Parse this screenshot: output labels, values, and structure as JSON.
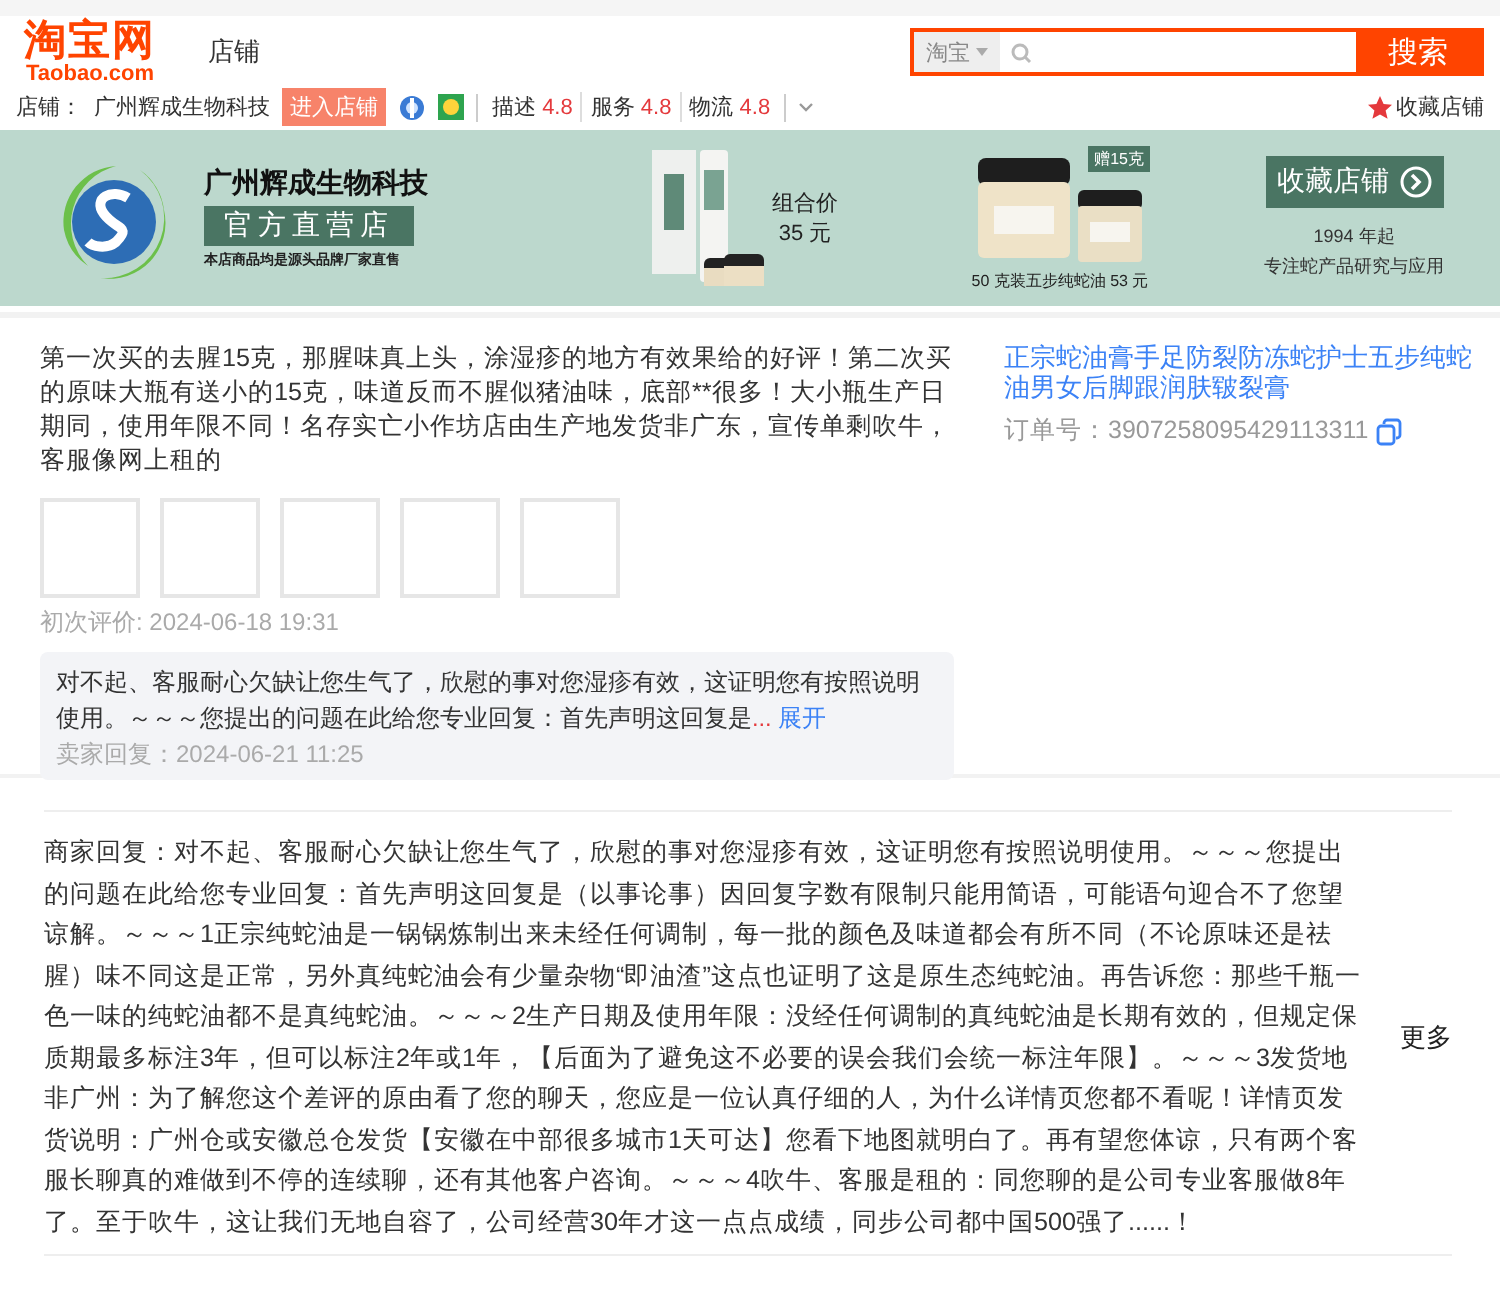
{
  "header": {
    "logo": "淘宝网",
    "logo_sub": "Taobao.com",
    "section": "店铺",
    "search": {
      "scope": "淘宝",
      "button": "搜索"
    }
  },
  "store_bar": {
    "label": "店铺：",
    "name": "广州辉成生物科技",
    "enter_button": "进入店铺",
    "ratings": [
      {
        "label": "描述",
        "score": "4.8"
      },
      {
        "label": "服务",
        "score": "4.8"
      },
      {
        "label": "物流",
        "score": "4.8"
      }
    ],
    "favorite": "收藏店铺"
  },
  "banner": {
    "store_name": "广州辉成生物科技",
    "store_type": "官方直营店",
    "slogan": "本店商品均是源头品牌厂家直售",
    "combo_label": "组合价",
    "combo_price": "35 元",
    "gift_badge": "赠15克",
    "offer": "50 克装五步纯蛇油 53 元",
    "favorite_button": "收藏店铺",
    "since": "1994 年起",
    "focus": "专注蛇产品研究与应用"
  },
  "review": {
    "text": "第一次买的去腥15克，那腥味真上头，涂湿疹的地方有效果给的好评！第二次买的原味大瓶有送小的15克，味道反而不腥似猪油味，底部**很多！大小瓶生产日期同，使用年限不同！名存实亡小作坊店由生产地发货非广东，宣传单剩吹牛，客服像网上租的",
    "photos": [
      {
        "kind": "empty"
      },
      {
        "kind": "empty"
      },
      {
        "kind": "empty"
      },
      {
        "kind": "empty"
      },
      {
        "kind": "empty"
      }
    ],
    "first_review_time": "初次评价: 2024-06-18 19:31",
    "seller_reply": {
      "text": "对不起、客服耐心欠缺让您生气了，欣慰的事对您湿疹有效，这证明您有按照说明使用。～～～您提出的问题在此给您专业回复：首先声明这回复是",
      "ellipsis": "...",
      "expand": "展开",
      "time": "卖家回复：2024-06-21 11:25"
    }
  },
  "product": {
    "title": "正宗蛇油膏手足防裂防冻蛇护士五步纯蛇油男女后脚跟润肤皲裂膏",
    "order_label": "订单号：",
    "order_number": "3907258095429113311"
  },
  "merchant_reply": {
    "text": "商家回复：对不起、客服耐心欠缺让您生气了，欣慰的事对您湿疹有效，这证明您有按照说明使用。～～～您提出的问题在此给您专业回复：首先声明这回复是（以事论事）因回复字数有限制只能用简语，可能语句迎合不了您望谅解。～～～1正宗纯蛇油是一锅锅炼制出来未经任何调制，每一批的颜色及味道都会有所不同（不论原味还是祛腥）味不同这是正常，另外真纯蛇油会有少量杂物“即油渣”这点也证明了这是原生态纯蛇油。再告诉您：那些千瓶一色一味的纯蛇油都不是真纯蛇油。～～～2生产日期及使用年限：没经任何调制的真纯蛇油是长期有效的，但规定保质期最多标注3年，但可以标注2年或1年，【后面为了避免这不必要的误会我们会统一标注年限】。～～～3发货地非广州：为了解您这个差评的原由看了您的聊天，您应是一位认真仔细的人，为什么详情页您都不看呢！详情页发货说明：广州仓或安徽总仓发货【安徽在中部很多城市1天可达】您看下地图就明白了。再有望您体谅，只有两个客服长聊真的难做到不停的连续聊，还有其他客户咨询。～～～4吹牛、客服是租的：同您聊的是公司专业客服做8年了。至于吹牛，这让我们无地自容了，公司经营30年才这一点点成绩，同步公司都中国500强了......！",
    "more": "更多"
  }
}
